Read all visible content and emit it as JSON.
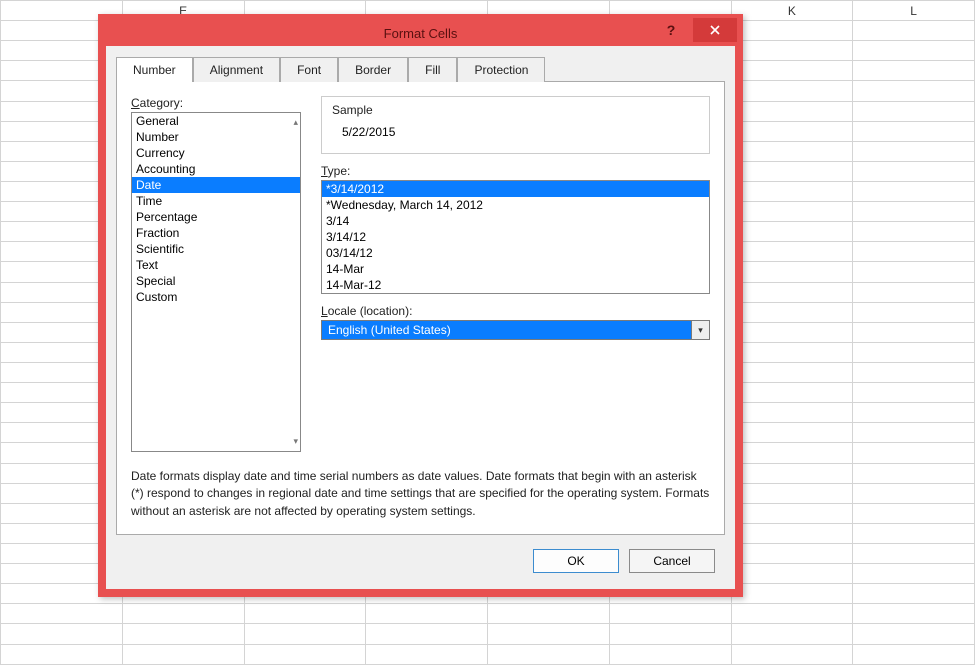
{
  "sheet": {
    "columns": [
      "",
      "E",
      "",
      "",
      "",
      "",
      "K",
      "L"
    ]
  },
  "dialog": {
    "title": "Format Cells",
    "help_tooltip": "?",
    "close_tooltip": "Close",
    "tabs": [
      {
        "label": "Number",
        "active": true
      },
      {
        "label": "Alignment",
        "active": false
      },
      {
        "label": "Font",
        "active": false
      },
      {
        "label": "Border",
        "active": false
      },
      {
        "label": "Fill",
        "active": false
      },
      {
        "label": "Protection",
        "active": false
      }
    ],
    "category_label": "Category:",
    "categories": [
      "General",
      "Number",
      "Currency",
      "Accounting",
      "Date",
      "Time",
      "Percentage",
      "Fraction",
      "Scientific",
      "Text",
      "Special",
      "Custom"
    ],
    "selected_category": "Date",
    "sample_label": "Sample",
    "sample_value": "5/22/2015",
    "type_label": "Type:",
    "types": [
      "*3/14/2012",
      "*Wednesday, March 14, 2012",
      "3/14",
      "3/14/12",
      "03/14/12",
      "14-Mar",
      "14-Mar-12"
    ],
    "selected_type": "*3/14/2012",
    "locale_label": "Locale (location):",
    "locale_value": "English (United States)",
    "description": "Date formats display date and time serial numbers as date values.  Date formats that begin with an asterisk (*) respond to changes in regional date and time settings that are specified for the operating system. Formats without an asterisk are not affected by operating system settings.",
    "ok_label": "OK",
    "cancel_label": "Cancel"
  }
}
